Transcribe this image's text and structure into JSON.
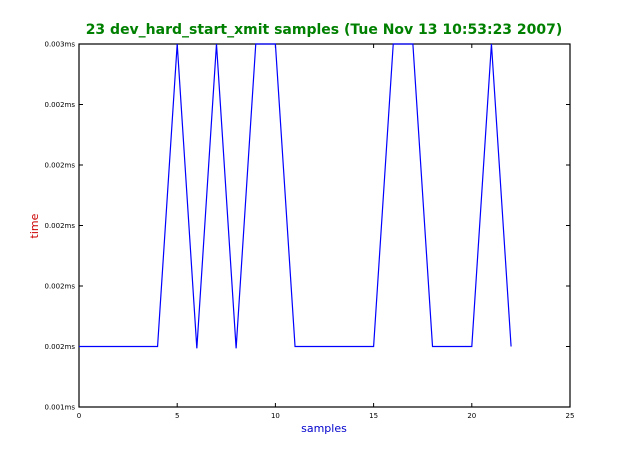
{
  "chart_data": {
    "type": "line",
    "title": "23 dev_hard_start_xmit samples (Tue Nov 13 10:53:23 2007)",
    "xlabel": "samples",
    "ylabel": "time",
    "colors": {
      "title": "#008000",
      "xlabel": "#0000cc",
      "ylabel": "#cc0000",
      "line": "#0000ff"
    },
    "xlim": [
      0,
      25
    ],
    "ylim": [
      0,
      6
    ],
    "x_ticks": [
      0,
      5,
      10,
      15,
      20,
      25
    ],
    "y_ticks": [
      {
        "value": 0,
        "label": "0.001ms"
      },
      {
        "value": 1,
        "label": "0.002ms"
      },
      {
        "value": 2,
        "label": "0.002ms"
      },
      {
        "value": 3,
        "label": "0.002ms"
      },
      {
        "value": 4,
        "label": "0.002ms"
      },
      {
        "value": 5,
        "label": "0.002ms"
      },
      {
        "value": 6,
        "label": "0.003ms"
      }
    ],
    "grid": false,
    "series": [
      {
        "x": [
          0,
          1,
          2,
          3,
          4,
          5,
          6,
          7,
          8,
          9,
          10,
          11,
          12,
          13,
          14,
          15,
          16,
          17,
          18,
          19,
          20,
          21,
          22
        ],
        "values": [
          1,
          1,
          1,
          1,
          1,
          6,
          0.97,
          6,
          0.97,
          6,
          6,
          1,
          1,
          1,
          1,
          1,
          6,
          6,
          1,
          1,
          1,
          6,
          1
        ]
      }
    ]
  }
}
